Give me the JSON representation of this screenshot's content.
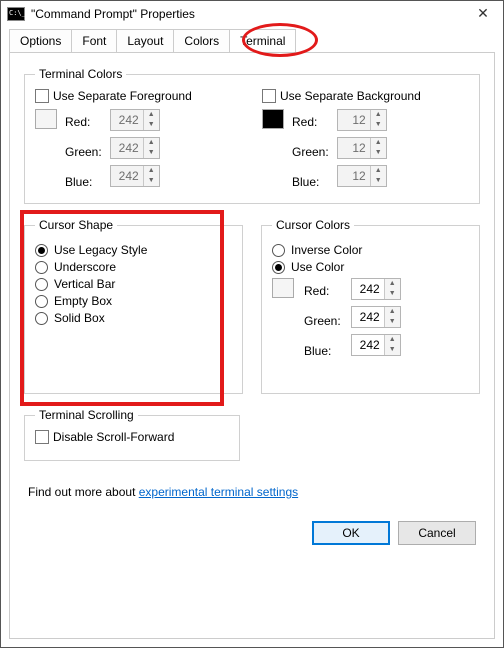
{
  "window": {
    "title": "\"Command Prompt\" Properties"
  },
  "tabs": {
    "options": "Options",
    "font": "Font",
    "layout": "Layout",
    "colors": "Colors",
    "terminal": "Terminal"
  },
  "terminalColors": {
    "legend": "Terminal Colors",
    "sepFg": "Use Separate Foreground",
    "sepBg": "Use Separate Background",
    "red": "Red:",
    "green": "Green:",
    "blue": "Blue:",
    "fg_r": "242",
    "fg_g": "242",
    "fg_b": "242",
    "bg_r": "12",
    "bg_g": "12",
    "bg_b": "12"
  },
  "cursorShape": {
    "legend": "Cursor Shape",
    "legacy": "Use Legacy Style",
    "underscore": "Underscore",
    "vbar": "Vertical Bar",
    "empty": "Empty Box",
    "solid": "Solid Box"
  },
  "cursorColors": {
    "legend": "Cursor Colors",
    "inverse": "Inverse Color",
    "usecolor": "Use Color",
    "red": "Red:",
    "green": "Green:",
    "blue": "Blue:",
    "r": "242",
    "g": "242",
    "b": "242"
  },
  "scrolling": {
    "legend": "Terminal Scrolling",
    "disable": "Disable Scroll-Forward"
  },
  "linkline": {
    "prefix": "Find out more about ",
    "link": "experimental terminal settings"
  },
  "buttons": {
    "ok": "OK",
    "cancel": "Cancel"
  }
}
